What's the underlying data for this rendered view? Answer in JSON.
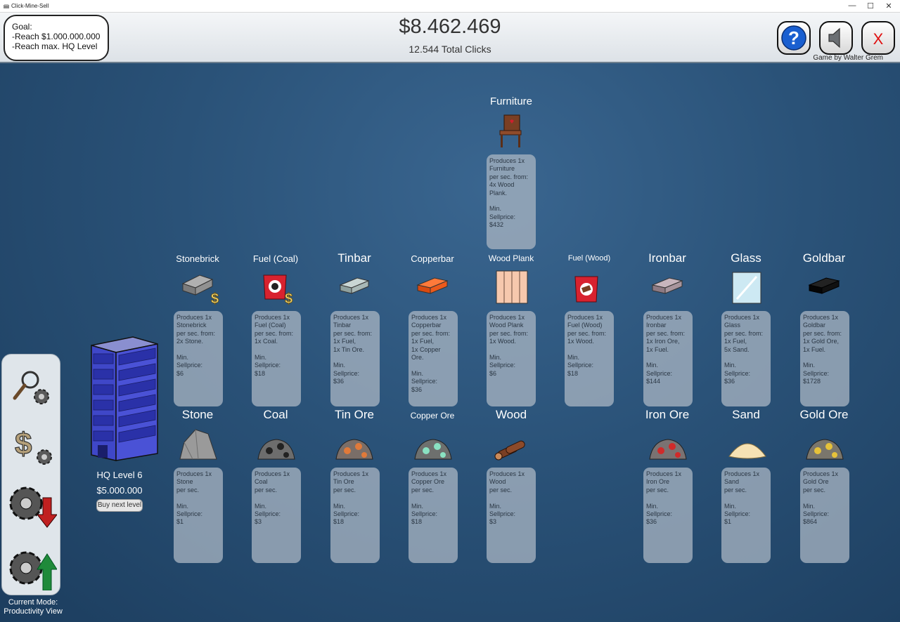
{
  "window": {
    "title": "Click-Mine-Sell",
    "minimize": "—",
    "maximize": "☐",
    "close": "✕"
  },
  "hud": {
    "goal": [
      "Goal:",
      "-Reach $1.000.000.000",
      "-Reach max. HQ Level"
    ],
    "money": "$8.462.469",
    "clicks": "12.544 Total Clicks",
    "help_label": "?",
    "close_label": "X",
    "credit": "Game by Walter Grem"
  },
  "hq": {
    "level": "HQ Level 6",
    "price": "$5.000.000",
    "buy_label": "Buy next level"
  },
  "mode": {
    "line1": "Current Mode:",
    "line2": "Productivity View"
  },
  "items": {
    "furniture": {
      "name": "Furniture",
      "desc": [
        "Produces 1x",
        "Furniture",
        "per sec. from:",
        "4x Wood",
        "Plank."
      ],
      "price_label": [
        "Min.",
        "Sellprice:"
      ],
      "price": "$432"
    },
    "stonebrick": {
      "name": "Stonebrick",
      "desc": [
        "Produces 1x",
        "Stonebrick",
        "per sec. from:",
        "2x Stone."
      ],
      "price_label": [
        "Min.",
        "Sellprice:"
      ],
      "price": "$6"
    },
    "fuel_coal": {
      "name": "Fuel (Coal)",
      "desc": [
        "Produces 1x",
        "Fuel (Coal)",
        "per sec. from:",
        "1x Coal."
      ],
      "price_label": [
        "Min.",
        "Sellprice:"
      ],
      "price": "$18"
    },
    "tinbar": {
      "name": "Tinbar",
      "desc": [
        "Produces 1x",
        "Tinbar",
        "per sec. from:",
        "1x Fuel,",
        "1x Tin Ore."
      ],
      "price_label": [
        "Min.",
        "Sellprice:"
      ],
      "price": "$36"
    },
    "copperbar": {
      "name": "Copperbar",
      "desc": [
        "Produces 1x",
        "Copperbar",
        "per sec. from:",
        "1x Fuel,",
        "1x Copper",
        "Ore."
      ],
      "price_label": [
        "Min.",
        "Sellprice:"
      ],
      "price": "$36"
    },
    "wood_plank": {
      "name": "Wood Plank",
      "desc": [
        "Produces 1x",
        "Wood Plank",
        "per sec. from:",
        "1x Wood."
      ],
      "price_label": [
        "Min.",
        "Sellprice:"
      ],
      "price": "$6"
    },
    "fuel_wood": {
      "name": "Fuel (Wood)",
      "desc": [
        "Produces 1x",
        "Fuel (Wood)",
        "per sec. from:",
        "1x Wood."
      ],
      "price_label": [
        "Min.",
        "Sellprice:"
      ],
      "price": "$18"
    },
    "ironbar": {
      "name": "Ironbar",
      "desc": [
        "Produces 1x",
        "Ironbar",
        "per sec. from:",
        "1x Iron Ore,",
        "1x Fuel."
      ],
      "price_label": [
        "Min.",
        "Sellprice:"
      ],
      "price": "$144"
    },
    "glass": {
      "name": "Glass",
      "desc": [
        "Produces 1x",
        "Glass",
        "per sec. from:",
        "1x Fuel,",
        "5x Sand."
      ],
      "price_label": [
        "Min.",
        "Sellprice:"
      ],
      "price": "$36"
    },
    "goldbar": {
      "name": "Goldbar",
      "desc": [
        "Produces 1x",
        "Goldbar",
        "per sec. from:",
        "1x Gold Ore,",
        "1x Fuel."
      ],
      "price_label": [
        "Min.",
        "Sellprice:"
      ],
      "price": "$1728"
    },
    "stone": {
      "name": "Stone",
      "desc": [
        "Produces 1x",
        "Stone",
        "per sec."
      ],
      "price_label": [
        "Min.",
        "Sellprice:"
      ],
      "price": "$1"
    },
    "coal": {
      "name": "Coal",
      "desc": [
        "Produces 1x",
        "Coal",
        "per sec."
      ],
      "price_label": [
        "Min.",
        "Sellprice:"
      ],
      "price": "$3"
    },
    "tin_ore": {
      "name": "Tin Ore",
      "desc": [
        "Produces 1x",
        "Tin Ore",
        "per sec."
      ],
      "price_label": [
        "Min.",
        "Sellprice:"
      ],
      "price": "$18"
    },
    "copper_ore": {
      "name": "Copper Ore",
      "desc": [
        "Produces 1x",
        "Copper Ore",
        "per sec."
      ],
      "price_label": [
        "Min.",
        "Sellprice:"
      ],
      "price": "$18"
    },
    "wood": {
      "name": "Wood",
      "desc": [
        "Produces 1x",
        "Wood",
        "per sec."
      ],
      "price_label": [
        "Min.",
        "Sellprice:"
      ],
      "price": "$3"
    },
    "iron_ore": {
      "name": "Iron Ore",
      "desc": [
        "Produces 1x",
        "Iron Ore",
        "per sec."
      ],
      "price_label": [
        "Min.",
        "Sellprice:"
      ],
      "price": "$36"
    },
    "sand": {
      "name": "Sand",
      "desc": [
        "Produces 1x",
        "Sand",
        "per sec."
      ],
      "price_label": [
        "Min.",
        "Sellprice:"
      ],
      "price": "$1"
    },
    "gold_ore": {
      "name": "Gold Ore",
      "desc": [
        "Produces 1x",
        "Gold Ore",
        "per sec."
      ],
      "price_label": [
        "Min.",
        "Sellprice:"
      ],
      "price": "$864"
    }
  }
}
